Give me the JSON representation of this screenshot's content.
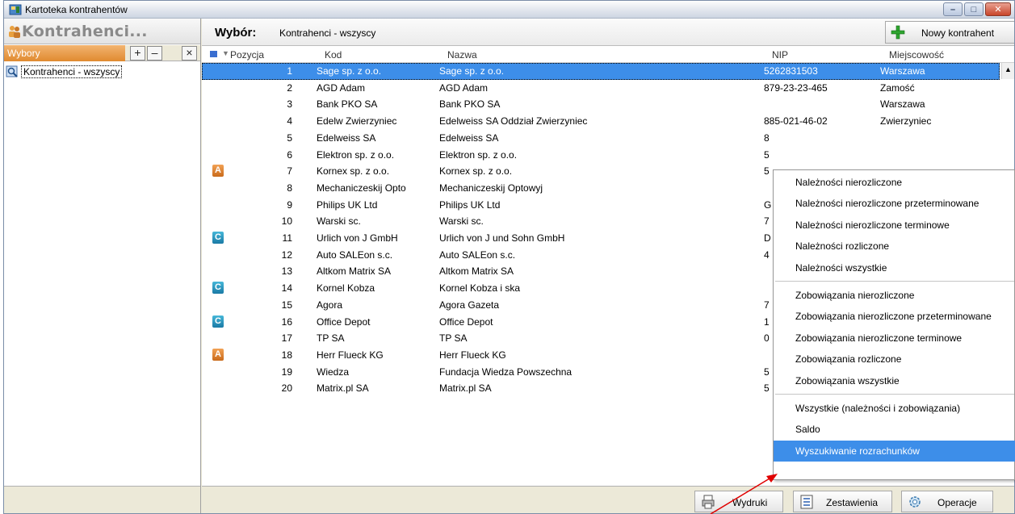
{
  "window": {
    "title": "Kartoteka kontrahentów"
  },
  "left_panel": {
    "header_title": "Kontrahenci...",
    "wybory_label": "Wybory",
    "add_symbol": "+",
    "remove_symbol": "–",
    "close_symbol": "×",
    "tree_item": "Kontrahenci - wszyscy"
  },
  "selection": {
    "label": "Wybór:",
    "value": "Kontrahenci - wszyscy",
    "new_button": "Nowy kontrahent"
  },
  "columns": {
    "pozycja": "Pozycja",
    "kod": "Kod",
    "nazwa": "Nazwa",
    "nip": "NIP",
    "miejscowosc": "Miejscowość"
  },
  "rows": [
    {
      "badge": "",
      "num": "1",
      "kod": "Sage sp. z o.o.",
      "nazwa": "Sage sp. z o.o.",
      "nip": "5262831503",
      "miasto": "Warszawa"
    },
    {
      "badge": "",
      "num": "2",
      "kod": "AGD Adam",
      "nazwa": "AGD Adam",
      "nip": "879-23-23-465",
      "miasto": "Zamość"
    },
    {
      "badge": "",
      "num": "3",
      "kod": "Bank PKO SA",
      "nazwa": "Bank PKO SA",
      "nip": "",
      "miasto": "Warszawa"
    },
    {
      "badge": "",
      "num": "4",
      "kod": "Edelw Zwierzyniec",
      "nazwa": "Edelweiss SA Oddział Zwierzyniec",
      "nip": "885-021-46-02",
      "miasto": "Zwierzyniec"
    },
    {
      "badge": "",
      "num": "5",
      "kod": "Edelweiss SA",
      "nazwa": "Edelweiss SA",
      "nip": "8",
      "miasto": ""
    },
    {
      "badge": "",
      "num": "6",
      "kod": "Elektron sp. z o.o.",
      "nazwa": "Elektron sp. z o.o.",
      "nip": "5",
      "miasto": ""
    },
    {
      "badge": "A",
      "num": "7",
      "kod": "Kornex sp. z o.o.",
      "nazwa": "Kornex sp. z o.o.",
      "nip": "5",
      "miasto": ""
    },
    {
      "badge": "",
      "num": "8",
      "kod": "Mechaniczeskij Opto",
      "nazwa": "Mechaniczeskij Optowyj",
      "nip": "",
      "miasto": ""
    },
    {
      "badge": "",
      "num": "9",
      "kod": "Philips UK Ltd",
      "nazwa": "Philips UK Ltd",
      "nip": "G",
      "miasto": ""
    },
    {
      "badge": "",
      "num": "10",
      "kod": "Warski sc.",
      "nazwa": "Warski sc.",
      "nip": "7",
      "miasto": ""
    },
    {
      "badge": "C",
      "num": "11",
      "kod": "Urlich von J GmbH",
      "nazwa": "Urlich von J und Sohn GmbH",
      "nip": "D",
      "miasto": ""
    },
    {
      "badge": "",
      "num": "12",
      "kod": "Auto SALEon s.c.",
      "nazwa": "Auto SALEon s.c.",
      "nip": "4",
      "miasto": ""
    },
    {
      "badge": "",
      "num": "13",
      "kod": "Altkom Matrix SA",
      "nazwa": "Altkom Matrix SA",
      "nip": "",
      "miasto": ""
    },
    {
      "badge": "C",
      "num": "14",
      "kod": "Kornel Kobza",
      "nazwa": "Kornel Kobza i ska",
      "nip": "",
      "miasto": ""
    },
    {
      "badge": "",
      "num": "15",
      "kod": "Agora",
      "nazwa": "Agora Gazeta",
      "nip": "7",
      "miasto": ""
    },
    {
      "badge": "C",
      "num": "16",
      "kod": "Office Depot",
      "nazwa": "Office Depot",
      "nip": "1",
      "miasto": ""
    },
    {
      "badge": "",
      "num": "17",
      "kod": "TP SA",
      "nazwa": "TP SA",
      "nip": "0",
      "miasto": ""
    },
    {
      "badge": "A",
      "num": "18",
      "kod": "Herr Flueck KG",
      "nazwa": "Herr Flueck KG",
      "nip": "",
      "miasto": ""
    },
    {
      "badge": "",
      "num": "19",
      "kod": "Wiedza",
      "nazwa": "Fundacja Wiedza Powszechna",
      "nip": "5",
      "miasto": ""
    },
    {
      "badge": "",
      "num": "20",
      "kod": "Matrix.pl SA",
      "nazwa": "Matrix.pl SA",
      "nip": "5",
      "miasto": ""
    }
  ],
  "context_menu": {
    "items": [
      "Należności nierozliczone",
      "Należności nierozliczone przeterminowane",
      "Należności nierozliczone terminowe",
      "Należności rozliczone",
      "Należności wszystkie",
      "Zobowiązania nierozliczone",
      "Zobowiązania nierozliczone przeterminowane",
      "Zobowiązania nierozliczone terminowe",
      "Zobowiązania rozliczone",
      "Zobowiązania wszystkie",
      "Wszystkie (należności i zobowiązania)",
      "Saldo",
      "Wyszukiwanie rozrachunków"
    ],
    "active_item": "Wyszukiwanie rozrachunków"
  },
  "bottom_bar": {
    "wydruki": "Wydruki",
    "zestawienia": "Zestawienia",
    "operacje": "Operacje"
  },
  "colors": {
    "selection": "#3d8ee9",
    "badge_a": "#e0802a",
    "badge_c": "#2a95c2",
    "wybory_tab": "#e8963c",
    "arrow": "#e00000"
  },
  "icons": {
    "app": "contacts-folder-icon",
    "header": "people-icon",
    "tree": "search-list-icon",
    "new": "green-plus-icon",
    "wydruki": "printer-icon",
    "zestawienia": "report-icon",
    "operacje": "gear-icon"
  }
}
